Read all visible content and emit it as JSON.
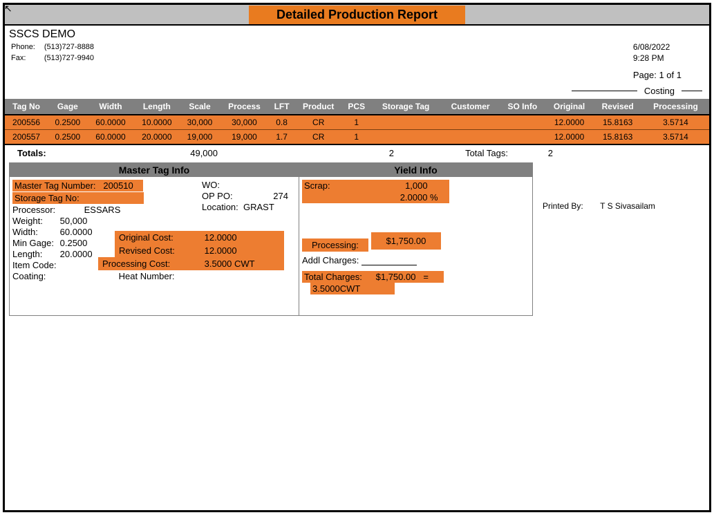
{
  "title": "Detailed Production Report",
  "company": "SSCS DEMO",
  "contact": {
    "phone_label": "Phone:",
    "phone": "(513)727-8888",
    "fax_label": "Fax:",
    "fax": "(513)727-9940"
  },
  "meta": {
    "date": "6/08/2022",
    "time": "9:28 PM",
    "page_label": "Page: 1 of 1"
  },
  "costing_label": "Costing",
  "headers": {
    "tag_no": "Tag No",
    "gage": "Gage",
    "width": "Width",
    "length": "Length",
    "scale": "Scale",
    "process": "Process",
    "lft": "LFT",
    "product": "Product",
    "pcs": "PCS",
    "storage_tag": "Storage Tag",
    "customer": "Customer",
    "so_info": "SO Info",
    "original": "Original",
    "revised": "Revised",
    "processing": "Processing"
  },
  "rows": [
    {
      "tag_no": "200556",
      "gage": "0.2500",
      "width": "60.0000",
      "length": "10.0000",
      "scale": "30,000",
      "process": "30,000",
      "lft": "0.8",
      "product": "CR",
      "pcs": "1",
      "storage_tag": "",
      "customer": "",
      "so_info": "",
      "original": "12.0000",
      "revised": "15.8163",
      "processing": "3.5714"
    },
    {
      "tag_no": "200557",
      "gage": "0.2500",
      "width": "60.0000",
      "length": "20.0000",
      "scale": "19,000",
      "process": "19,000",
      "lft": "1.7",
      "product": "CR",
      "pcs": "1",
      "storage_tag": "",
      "customer": "",
      "so_info": "",
      "original": "12.0000",
      "revised": "15.8163",
      "processing": "3.5714"
    }
  ],
  "totals": {
    "label": "Totals:",
    "sum_process": "49,000",
    "pcs": "2",
    "total_tags_label": "Total Tags:",
    "total_tags": "2"
  },
  "master": {
    "panel_title": "Master Tag Info",
    "mtn_label": "Master Tag Number:",
    "mtn": "200510",
    "storage_label": "Storage Tag No:",
    "storage": "",
    "processor_label": "Processor:",
    "processor": "ESSARS",
    "weight_label": "Weight:",
    "weight": "50,000",
    "width_label": "Width:",
    "width": "60.0000",
    "min_gage_label": "Min Gage:",
    "min_gage": "0.2500",
    "length_label": "Length:",
    "length": "20.0000",
    "item_code_label": "Item Code:",
    "coating_label": "Coating:",
    "wo_label": "WO:",
    "op_po_label": "OP PO:",
    "op_po": "274",
    "location_label": "Location:",
    "location": "GRAST",
    "orig_cost_label": "Original Cost:",
    "orig_cost": "12.0000",
    "rev_cost_label": "Revised Cost:",
    "rev_cost": "12.0000",
    "proc_cost_label": "Processing Cost:",
    "proc_cost": "3.5000 CWT",
    "heat_label": "Heat Number:"
  },
  "yield": {
    "panel_title": "Yield Info",
    "scrap_label": "Scrap:",
    "scrap_amt": "1,000",
    "scrap_pct": "2.0000 %",
    "processing_label": "Processing:",
    "processing_amt": "$1,750.00",
    "addl_label": "Addl Charges:",
    "total_label": "Total Charges:",
    "total_amt": "$1,750.00",
    "eq": "=",
    "total_rate": "3.5000CWT"
  },
  "printed_by": {
    "label": "Printed By:",
    "name": "T S Sivasailam"
  }
}
